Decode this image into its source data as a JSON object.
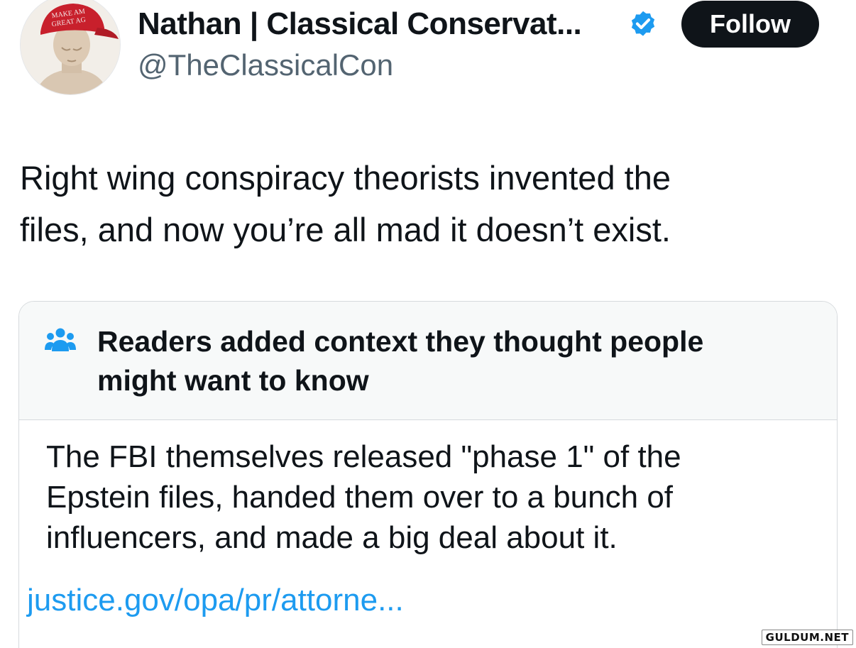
{
  "author": {
    "display_name": "Nathan | Classical Conservat...",
    "handle": "@TheClassicalCon",
    "avatar_cap_text": [
      "MAKE AM",
      "GREAT AG"
    ],
    "verified_icon": "verified-badge-icon",
    "follow_label": "Follow"
  },
  "tweet": {
    "lines": [
      "Right wing conspiracy theorists invented the",
      "files, and now you’re all mad it doesn’t exist."
    ]
  },
  "community_note": {
    "icon": "people-icon",
    "title_lines": [
      "Readers added context they thought people",
      "might want to know"
    ],
    "body_lines": [
      "The FBI themselves released \"phase 1\" of the",
      "Epstein files, handed them over to a bunch of",
      "influencers, and made a big deal about it."
    ],
    "link_text": "justice.gov/opa/pr/attorne..."
  },
  "watermark": "GULDUM.NET",
  "colors": {
    "text": "#0f1419",
    "secondary_text": "#536471",
    "link": "#1d9bf0",
    "verified": "#1d9bf0",
    "follow_bg": "#0f1419",
    "note_header_bg": "#f7f9f9",
    "border": "#d6dadd",
    "cap_red": "#c8202c"
  }
}
